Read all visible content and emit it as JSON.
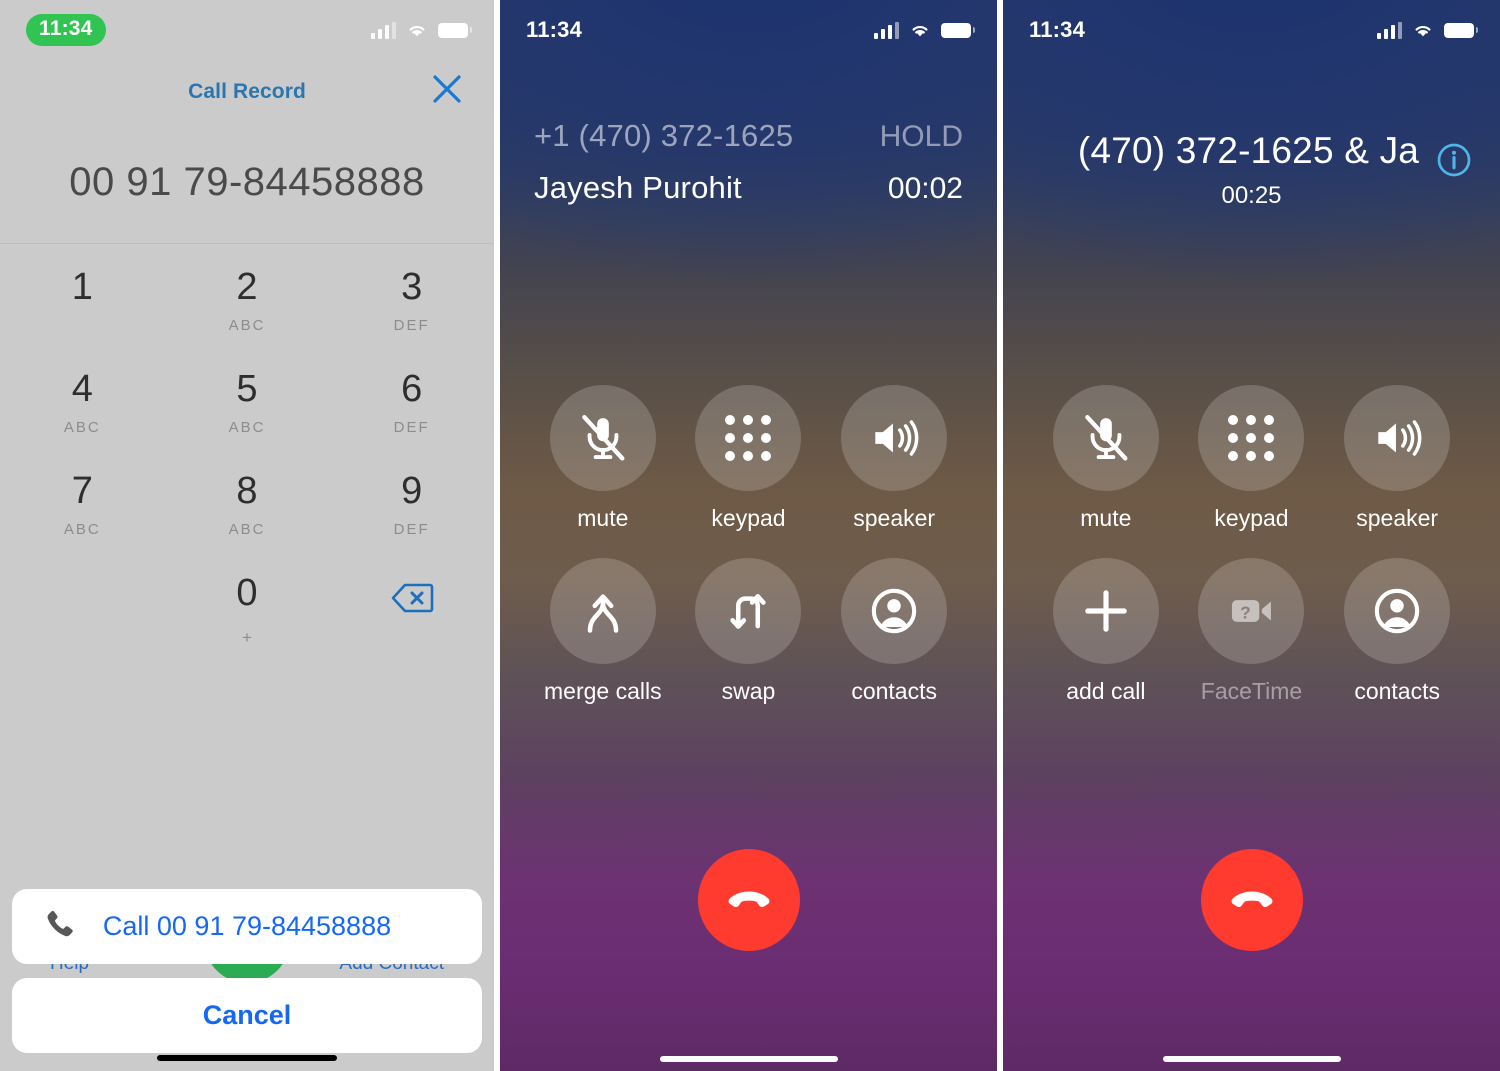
{
  "panels": {
    "dialer": {
      "status": {
        "time": "11:34",
        "recording_pill_color": "#31c452",
        "signal_icon": "signal-bars-icon",
        "wifi_icon": "wifi-icon",
        "battery_icon": "battery-icon"
      },
      "sheet_title": "Call Record",
      "close_icon": "close-x-icon",
      "typed_number": "00 91 79-84458888",
      "keys": [
        {
          "digit": "1",
          "letters": ""
        },
        {
          "digit": "2",
          "letters": "ABC"
        },
        {
          "digit": "3",
          "letters": "DEF"
        },
        {
          "digit": "4",
          "letters": "ABC"
        },
        {
          "digit": "5",
          "letters": "ABC"
        },
        {
          "digit": "6",
          "letters": "DEF"
        },
        {
          "digit": "7",
          "letters": "ABC"
        },
        {
          "digit": "8",
          "letters": "ABC"
        },
        {
          "digit": "9",
          "letters": "DEF"
        },
        {
          "digit": "0",
          "letters": "+"
        }
      ],
      "delete_icon": "backspace-icon",
      "behind": {
        "help_label": "Help",
        "add_contact_label": "Add Contact",
        "call_button_color": "#2cab55"
      },
      "call_action": {
        "icon": "phone-handset-icon",
        "label": "Call 00 91 79-84458888"
      },
      "cancel_action": {
        "label": "Cancel"
      }
    },
    "two_calls": {
      "status": {
        "time": "11:34"
      },
      "call_rows": [
        {
          "who": "+1 (470) 372-1625",
          "meta": "HOLD",
          "state": "on-hold"
        },
        {
          "who": "Jayesh Purohit",
          "meta": "00:02",
          "state": "active"
        }
      ],
      "controls": [
        {
          "label": "mute",
          "icon": "mic-muted-icon",
          "enabled": true
        },
        {
          "label": "keypad",
          "icon": "keypad-dots-icon",
          "enabled": true
        },
        {
          "label": "speaker",
          "icon": "speaker-icon",
          "enabled": true
        },
        {
          "label": "merge calls",
          "icon": "merge-arrow-icon",
          "enabled": true
        },
        {
          "label": "swap",
          "icon": "swap-arrows-icon",
          "enabled": true
        },
        {
          "label": "contacts",
          "icon": "contacts-person-icon",
          "enabled": true
        }
      ],
      "end_call": {
        "icon": "end-call-handset-icon",
        "color": "#ff3b2f"
      }
    },
    "merged_call": {
      "status": {
        "time": "11:34"
      },
      "title": "(470) 372-1625 & Ja",
      "timer": "00:25",
      "info_icon": "info-circle-icon",
      "controls": [
        {
          "label": "mute",
          "icon": "mic-muted-icon",
          "enabled": true
        },
        {
          "label": "keypad",
          "icon": "keypad-dots-icon",
          "enabled": true
        },
        {
          "label": "speaker",
          "icon": "speaker-icon",
          "enabled": true
        },
        {
          "label": "add call",
          "icon": "plus-icon",
          "enabled": true
        },
        {
          "label": "FaceTime",
          "icon": "facetime-video-icon",
          "enabled": false
        },
        {
          "label": "contacts",
          "icon": "contacts-person-icon",
          "enabled": true
        }
      ],
      "end_call": {
        "icon": "end-call-handset-icon",
        "color": "#ff3b2f"
      }
    }
  }
}
